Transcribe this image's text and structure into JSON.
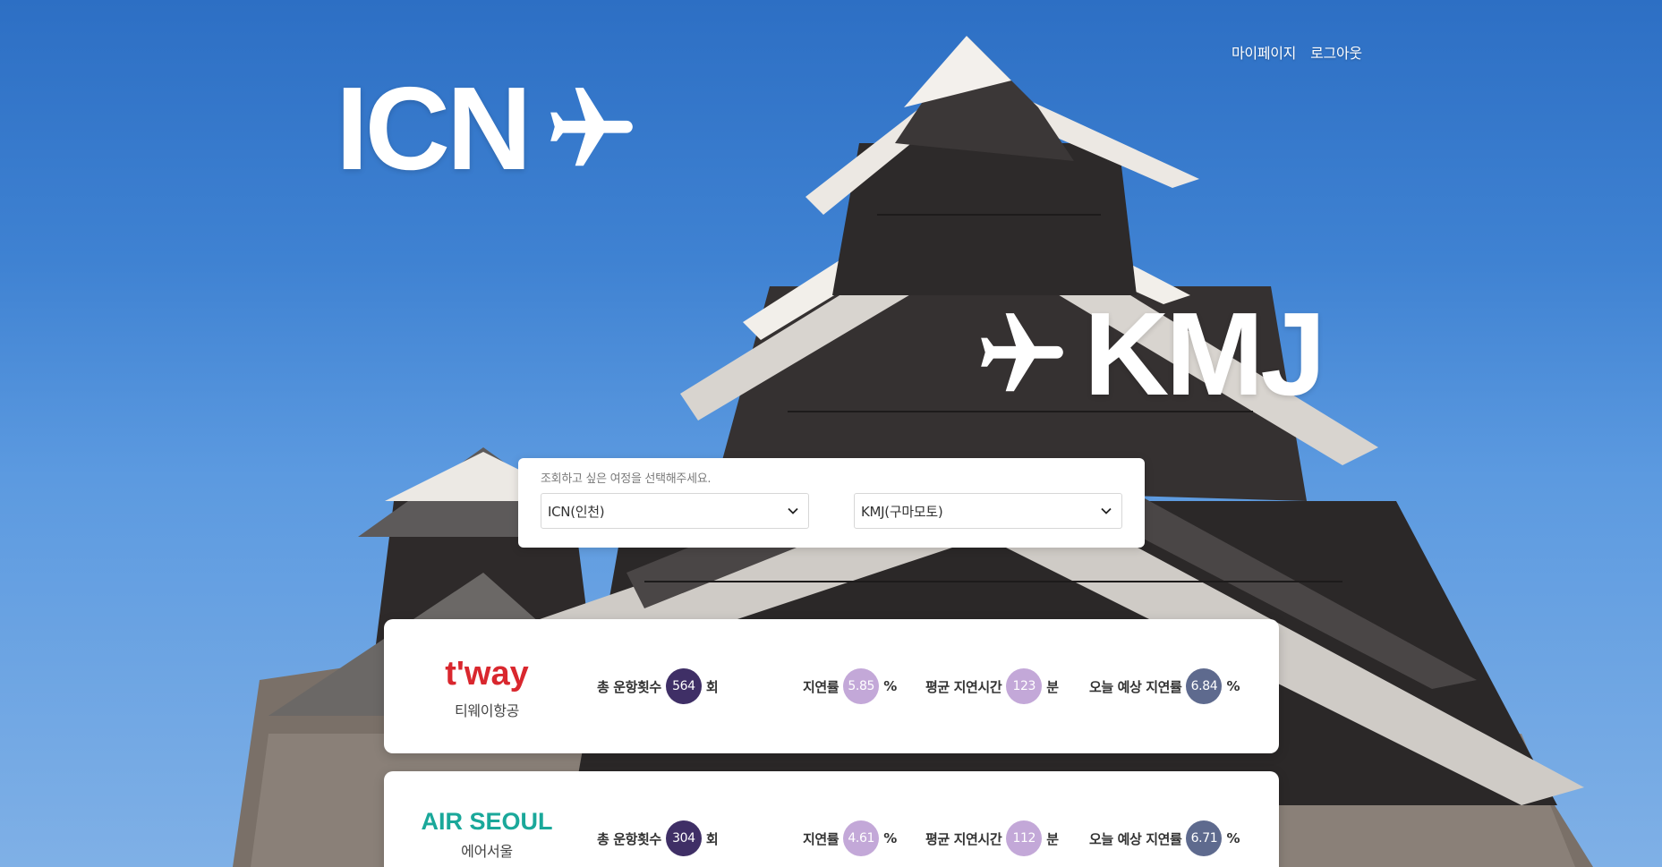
{
  "nav": {
    "mypage": "마이페이지",
    "logout": "로그아웃"
  },
  "hero": {
    "from_code": "ICN",
    "to_code": "KMJ",
    "plane_icon": "airplane-icon"
  },
  "selector": {
    "hint": "조회하고 싶은 여정을 선택해주세요.",
    "from_value": "ICN(인천)",
    "to_value": "KMJ(구마모토)"
  },
  "airlines": [
    {
      "logo_text": "t'way",
      "name": "티웨이항공",
      "total_label": "총 운항횟수",
      "total": "564",
      "total_unit": "회",
      "rate_label": "지연률",
      "rate": "5.85",
      "rate_unit": "%",
      "avg_label": "평균 지연시간",
      "avg": "123",
      "avg_unit": "분",
      "today_label": "오늘 예상 지연률",
      "today": "6.84",
      "today_unit": "%"
    },
    {
      "logo_text": "AIR SEOUL",
      "name": "에어서울",
      "total_label": "총 운항횟수",
      "total": "304",
      "total_unit": "회",
      "rate_label": "지연률",
      "rate": "4.61",
      "rate_unit": "%",
      "avg_label": "평균 지연시간",
      "avg": "112",
      "avg_unit": "분",
      "today_label": "오늘 예상 지연률",
      "today": "6.71",
      "today_unit": "%"
    }
  ],
  "colors": {
    "sky_top": "#2d6fc4",
    "tway_red": "#d9272e",
    "airseoul_green": "#1aa89a",
    "badge_dark": "#3f2f66",
    "badge_light": "#c3a8d8",
    "badge_slate": "#5e6a8e"
  }
}
